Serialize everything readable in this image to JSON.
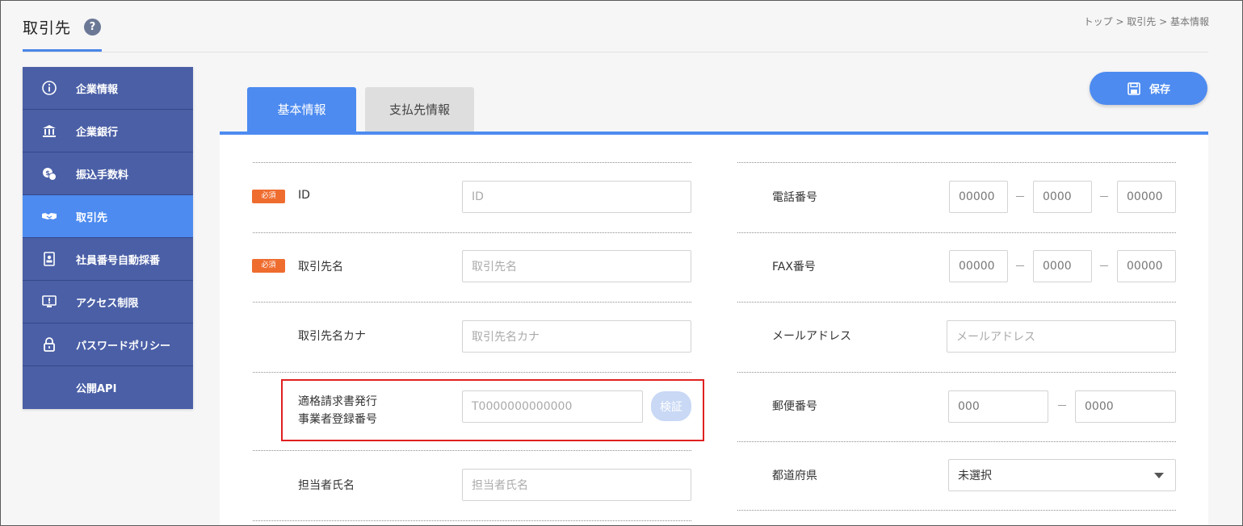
{
  "header": {
    "title": "取引先",
    "help_icon": "?",
    "breadcrumb": "トップ > 取引先 > 基本情報"
  },
  "sidebar": {
    "items": [
      {
        "label": "企業情報",
        "icon": "info-icon",
        "active": false
      },
      {
        "label": "企業銀行",
        "icon": "bank-icon",
        "active": false
      },
      {
        "label": "振込手数料",
        "icon": "money-icon",
        "active": false
      },
      {
        "label": "取引先",
        "icon": "handshake-icon",
        "active": true
      },
      {
        "label": "社員番号自動採番",
        "icon": "id-card-icon",
        "active": false
      },
      {
        "label": "アクセス制限",
        "icon": "monitor-icon",
        "active": false
      },
      {
        "label": "パスワードポリシー",
        "icon": "lock-icon",
        "active": false
      },
      {
        "label": "公開API",
        "icon": "",
        "active": false
      }
    ]
  },
  "tabs": {
    "basic": "基本情報",
    "payment": "支払先情報"
  },
  "actions": {
    "save": "保存"
  },
  "form": {
    "required_badge": "必須",
    "left": {
      "id": {
        "label": "ID",
        "placeholder": "ID"
      },
      "name": {
        "label": "取引先名",
        "placeholder": "取引先名"
      },
      "kana": {
        "label": "取引先名カナ",
        "placeholder": "取引先名カナ"
      },
      "invoice": {
        "label_line1": "適格請求書発行",
        "label_line2": "事業者登録番号",
        "placeholder": "T0000000000000",
        "verify": "検証"
      },
      "contact": {
        "label": "担当者氏名",
        "placeholder": "担当者氏名"
      }
    },
    "right": {
      "phone": {
        "label": "電話番号",
        "p1": "00000",
        "p2": "0000",
        "p3": "00000"
      },
      "fax": {
        "label": "FAX番号",
        "p1": "00000",
        "p2": "0000",
        "p3": "00000"
      },
      "email": {
        "label": "メールアドレス",
        "placeholder": "メールアドレス"
      },
      "postal": {
        "label": "郵便番号",
        "p1": "000",
        "p2": "0000"
      },
      "prefecture": {
        "label": "都道府県",
        "value": "未選択"
      }
    },
    "dash": "－"
  },
  "colors": {
    "accent": "#4d8bf0",
    "sidebar": "#4a5fa6",
    "required": "#ef6c2f",
    "highlight": "#e02020"
  }
}
